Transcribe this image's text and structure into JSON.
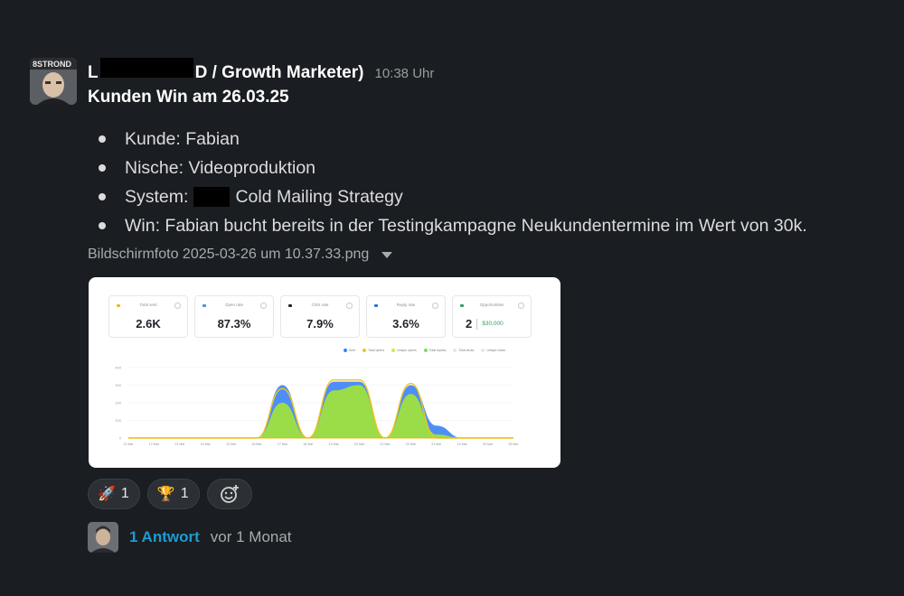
{
  "message": {
    "author_visible": "L",
    "author_suffix": "D / Growth Marketer)",
    "timestamp": "10:38 Uhr",
    "title": "Kunden Win am 26.03.25",
    "bullets": [
      "Kunde: Fabian",
      "Nische: Videoproduktion",
      "System:",
      "Win: Fabian bucht bereits in der Testingkampagne Neukundentermine im Wert von 30k."
    ],
    "system_suffix": "Cold Mailing Strategy",
    "attachment_name": "Bildschirmfoto 2025-03-26 um 10.37.33.png",
    "avatar_text": "8STROND"
  },
  "screenshot": {
    "kpis": [
      {
        "label": "Total sent",
        "value": "2.6K",
        "color": "#f0b429"
      },
      {
        "label": "Open rate",
        "value": "87.3%",
        "color": "#4f8fe0"
      },
      {
        "label": "Click rate",
        "value": "7.9%",
        "color": "#1f2328"
      },
      {
        "label": "Reply rate",
        "value": "3.6%",
        "color": "#2f6fd6"
      },
      {
        "label": "Opportunities",
        "value": "2",
        "extra": "$30,000",
        "color": "#2f9e64"
      }
    ],
    "legend": [
      {
        "label": "Sent",
        "color": "#3b82f6"
      },
      {
        "label": "Total opens",
        "color": "#f5c518"
      },
      {
        "label": "Unique opens",
        "color": "#d6e84a"
      },
      {
        "label": "Total replies",
        "color": "#7fdc6e"
      },
      {
        "label": "Total clicks",
        "color": "#e5e7eb"
      },
      {
        "label": "Unique clicks",
        "color": "#e5e7eb"
      }
    ]
  },
  "chart_data": {
    "type": "area",
    "x": [
      "11 Mar",
      "12 Mar",
      "13 Mar",
      "14 Mar",
      "15 Mar",
      "16 Mar",
      "17 Mar",
      "18 Mar",
      "19 Mar",
      "20 Mar",
      "21 Mar",
      "22 Mar",
      "23 Mar",
      "24 Mar",
      "25 Mar",
      "26 Mar"
    ],
    "y_ticks": [
      "0",
      "100",
      "200",
      "300",
      "400"
    ],
    "ylim": [
      0,
      400
    ],
    "series": [
      {
        "name": "Sent",
        "color": "#3b82f6",
        "values": [
          0,
          0,
          0,
          0,
          0,
          0,
          300,
          0,
          320,
          320,
          0,
          300,
          70,
          0,
          0,
          0
        ]
      },
      {
        "name": "Total opens",
        "color": "#f5c518",
        "values": [
          0,
          0,
          0,
          0,
          0,
          0,
          280,
          0,
          330,
          330,
          0,
          310,
          0,
          0,
          0,
          0
        ]
      },
      {
        "name": "Unique opens",
        "color": "#a3e635",
        "values": [
          0,
          0,
          0,
          0,
          0,
          0,
          200,
          0,
          270,
          300,
          0,
          250,
          20,
          0,
          0,
          0
        ]
      },
      {
        "name": "Total replies",
        "color": "#7fdc6e",
        "values": [
          0,
          0,
          0,
          0,
          0,
          0,
          0,
          0,
          0,
          0,
          0,
          0,
          0,
          0,
          0,
          0
        ]
      }
    ]
  },
  "reactions": [
    {
      "emoji": "🚀",
      "count": "1"
    },
    {
      "emoji": "🏆",
      "count": "1"
    }
  ],
  "thread": {
    "replies": "1 Antwort",
    "ago": "vor 1 Monat"
  }
}
